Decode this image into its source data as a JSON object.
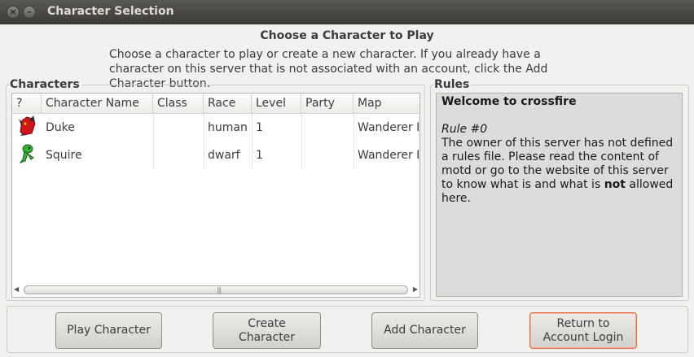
{
  "window": {
    "title": "Character Selection"
  },
  "header": {
    "heading": "Choose a Character to Play",
    "intro": "Choose a character to play or create a new character.  If you already have a character on this server that is not associated with an account, click the Add Character button."
  },
  "characters": {
    "label": "Characters",
    "columns": [
      "?",
      "Character Name",
      "Class",
      "Race",
      "Level",
      "Party",
      "Map"
    ],
    "rows": [
      {
        "icon": "red-dragon-icon",
        "name": "Duke",
        "class": "",
        "race": "human",
        "level": "1",
        "party": "",
        "map": "Wanderer Inn"
      },
      {
        "icon": "green-creature-icon",
        "name": "Squire",
        "class": "",
        "race": "dwarf",
        "level": "1",
        "party": "",
        "map": "Wanderer Inn"
      }
    ]
  },
  "rules": {
    "label": "Rules",
    "title": "Welcome to crossfire",
    "rule_number": "Rule #0",
    "text_before_bold": "The owner of this server has not defined a rules file. Please read the content of motd or go to the website of this server to know what is and what is ",
    "bold_word": "not",
    "text_after_bold": " allowed here."
  },
  "buttons": {
    "play": "Play Character",
    "create": "Create Character",
    "add": "Add Character",
    "return_line1": "Return to",
    "return_line2": "Account Login"
  },
  "colors": {
    "titlebar": "#3d3c38",
    "window_bg": "#f2f1f0",
    "rules_bg": "#dcdcdc",
    "default_button_border": "#e5693f"
  }
}
